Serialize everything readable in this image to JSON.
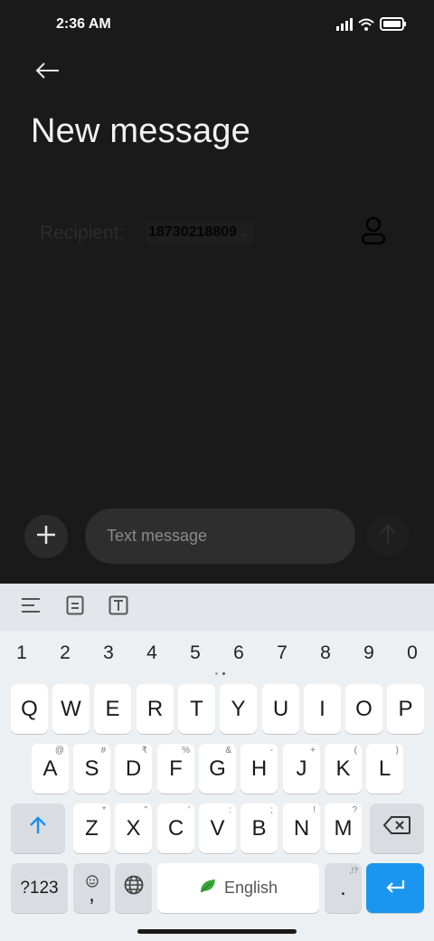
{
  "status_bar": {
    "time": "2:36 AM"
  },
  "header": {
    "title": "New message"
  },
  "recipient": {
    "label": "Recipient:",
    "number": "18730218809",
    "chevron": "⌄"
  },
  "compose": {
    "placeholder": "Text message"
  },
  "keyboard": {
    "numbers": [
      "1",
      "2",
      "3",
      "4",
      "5",
      "6",
      "7",
      "8",
      "9",
      "0"
    ],
    "row1": [
      {
        "k": "Q"
      },
      {
        "k": "W"
      },
      {
        "k": "E"
      },
      {
        "k": "R"
      },
      {
        "k": "T"
      },
      {
        "k": "Y"
      },
      {
        "k": "U"
      },
      {
        "k": "I"
      },
      {
        "k": "O"
      },
      {
        "k": "P"
      }
    ],
    "row2": [
      {
        "k": "A",
        "h": "@"
      },
      {
        "k": "S",
        "h": "#"
      },
      {
        "k": "D",
        "h": "₹"
      },
      {
        "k": "F",
        "h": "%"
      },
      {
        "k": "G",
        "h": "&"
      },
      {
        "k": "H",
        "h": "-"
      },
      {
        "k": "J",
        "h": "+"
      },
      {
        "k": "K",
        "h": "("
      },
      {
        "k": "L",
        "h": ")"
      }
    ],
    "row3": [
      {
        "k": "Z",
        "h": "*"
      },
      {
        "k": "X",
        "h": "\""
      },
      {
        "k": "C",
        "h": "'"
      },
      {
        "k": "V",
        "h": ":"
      },
      {
        "k": "B",
        "h": ";"
      },
      {
        "k": "N",
        "h": "!"
      },
      {
        "k": "M",
        "h": "?"
      }
    ],
    "sym_label": "?123",
    "comma": ",",
    "space_label": "English",
    "period": ".",
    "period_hint": ",!?"
  },
  "icons": {
    "back": "arrow-left-icon",
    "contact": "person-icon",
    "attach": "plus-icon",
    "send": "arrow-up-icon",
    "shift": "shift-arrow-icon",
    "backspace": "backspace-icon",
    "emoji": "emoji-icon",
    "globe": "globe-icon",
    "enter": "enter-icon",
    "leaf": "leaf-icon"
  },
  "colors": {
    "background": "#1a1a1a",
    "keyboard": "#edf0f3",
    "accent": "#1a96f0",
    "leaf": "#3aa53a"
  }
}
